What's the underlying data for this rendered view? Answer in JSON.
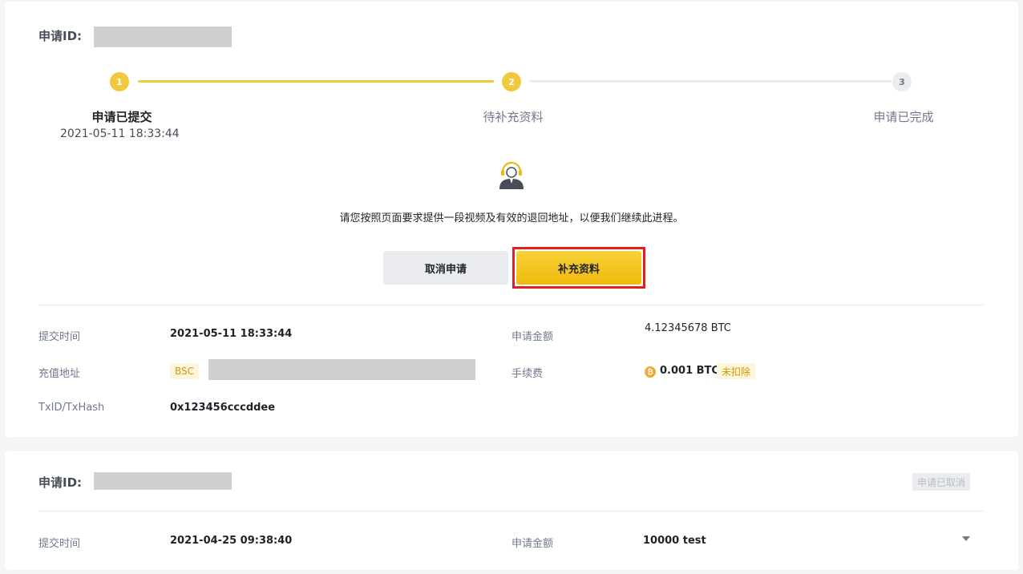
{
  "card1": {
    "id_label": "申请ID:",
    "steps": [
      {
        "number": "1",
        "title": "申请已提交",
        "time": "2021-05-11 18:33:44"
      },
      {
        "number": "2",
        "title": "待补充资料"
      },
      {
        "number": "3",
        "title": "申请已完成"
      }
    ],
    "message": "请您按照页面要求提供一段视频及有效的退回地址，以便我们继续此进程。",
    "buttons": {
      "cancel": "取消申请",
      "supplement": "补充资料"
    },
    "details": {
      "submit_time_label": "提交时间",
      "submit_time_value": "2021-05-11 18:33:44",
      "deposit_address_label": "充值地址",
      "network_tag": "BSC",
      "txid_label": "TxID/TxHash",
      "txid_value": "0x123456cccddee",
      "amount_label": "申请金额",
      "amount_value": "4.12345678 BTC",
      "fee_label": "手续费",
      "fee_value": "0.001 BTC",
      "fee_status": "未扣除",
      "coin_symbol": "₿"
    }
  },
  "card2": {
    "id_label": "申请ID:",
    "status": "申请已取消",
    "submit_time_label": "提交时间",
    "submit_time_value": "2021-04-25 09:38:40",
    "amount_label": "申请金额",
    "amount_value": "10000 test"
  },
  "colors": {
    "accent": "#f0b90b",
    "step_active": "#f0c93e",
    "highlight": "#e02020",
    "tag_text": "#d0980b"
  }
}
